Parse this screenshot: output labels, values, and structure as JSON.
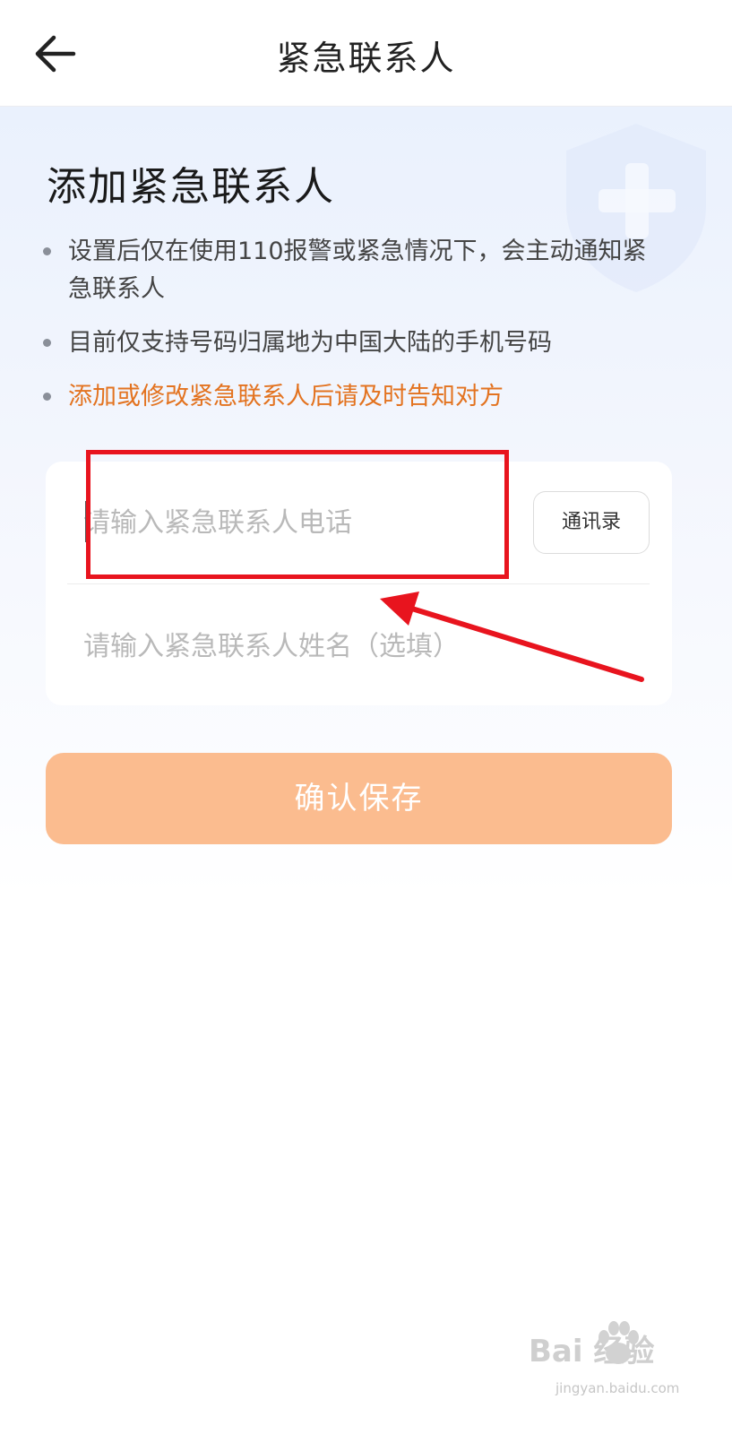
{
  "header": {
    "title": "紧急联系人",
    "back_icon": "arrow-left-icon"
  },
  "intro": {
    "title": "添加紧急联系人",
    "notes": [
      "设置后仅在使用110报警或紧急情况下，会主动通知紧急联系人",
      "目前仅支持号码归属地为中国大陆的手机号码",
      "添加或修改紧急联系人后请及时告知对方"
    ]
  },
  "form": {
    "phone_placeholder": "请输入紧急联系人电话",
    "contacts_label": "通讯录",
    "name_placeholder": "请输入紧急联系人姓名（选填）"
  },
  "actions": {
    "save_label": "确认保存"
  },
  "watermark": {
    "brand": "Bai  经验",
    "url": "jingyan.baidu.com"
  },
  "colors": {
    "warning_text": "#e37320",
    "save_button": "#fbbc8f",
    "annotation": "#e8141e",
    "background_tint": "#eaf1fd"
  }
}
